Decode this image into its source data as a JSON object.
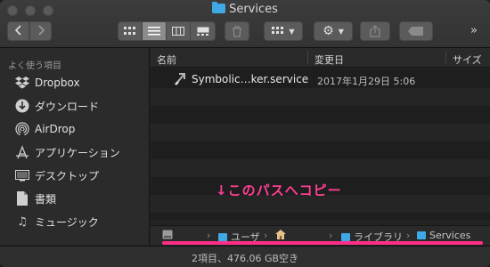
{
  "window": {
    "title": "Services"
  },
  "toolbar": {
    "back_icon": "chevron-left-icon",
    "forward_icon": "chevron-right-icon",
    "view_modes": [
      "icon-view",
      "list-view",
      "column-view",
      "gallery-view"
    ],
    "active_view": "list-view",
    "more_label": "»"
  },
  "sidebar": {
    "heading": "よく使う項目",
    "items": [
      {
        "label": "Dropbox",
        "icon": "dropbox-icon"
      },
      {
        "label": "ダウンロード",
        "icon": "download-icon"
      },
      {
        "label": "AirDrop",
        "icon": "airdrop-icon"
      },
      {
        "label": "アプリケーション",
        "icon": "applications-icon"
      },
      {
        "label": "デスクトップ",
        "icon": "desktop-icon"
      },
      {
        "label": "書類",
        "icon": "documents-icon"
      },
      {
        "label": "ミュージック",
        "icon": "music-icon"
      }
    ]
  },
  "columns": {
    "name": "名前",
    "date": "変更日",
    "size": "サイズ"
  },
  "files": [
    {
      "name": "Symbolic…ker.service",
      "date": "2017年1月29日 5:06",
      "icon": "alias-icon"
    }
  ],
  "annotation": "↓このパスへコピー",
  "pathbar": {
    "segments": [
      {
        "label": "",
        "icon": "disk-icon"
      },
      {
        "label": "ユーザ",
        "icon": "folder-icon"
      },
      {
        "label": "",
        "icon": "home-icon"
      },
      {
        "label": "ライブラリ",
        "icon": "folder-icon"
      },
      {
        "label": "Services",
        "icon": "folder-icon"
      }
    ],
    "separator": "›"
  },
  "status": "2項目、476.06 GB空き",
  "colors": {
    "accent_folder": "#3fa9e6",
    "annotation": "#ff3f94"
  }
}
